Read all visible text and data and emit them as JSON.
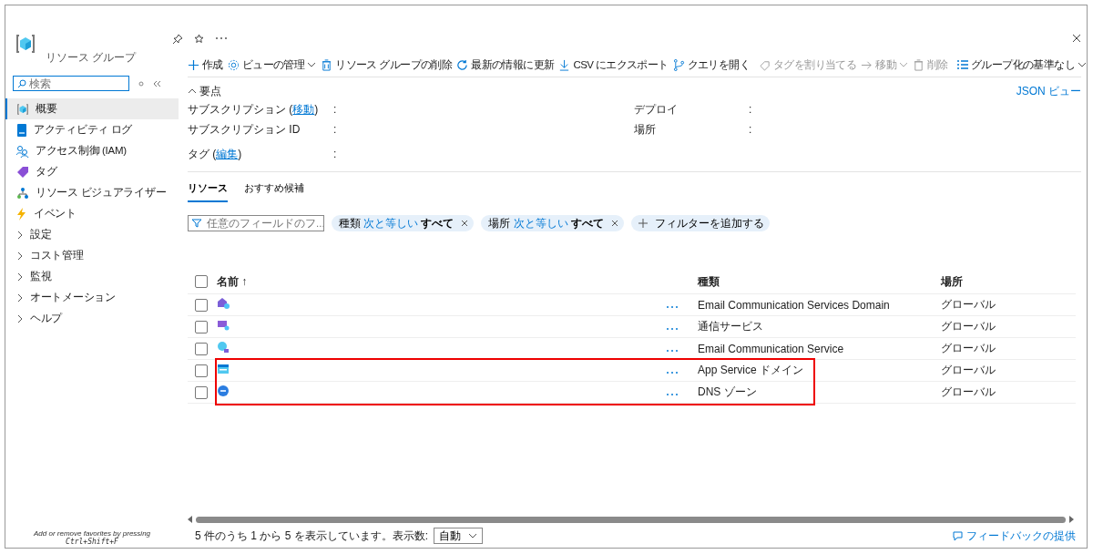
{
  "sidebar": {
    "title": "リソース グループ",
    "search": {
      "placeholder": "検索"
    },
    "items": [
      {
        "label": "概要",
        "kind": "link",
        "selected": true
      },
      {
        "label": "アクティビティ ログ",
        "kind": "link",
        "selected": false
      },
      {
        "label": "アクセス制御 (IAM)",
        "kind": "link",
        "selected": false
      },
      {
        "label": "タグ",
        "kind": "link",
        "selected": false
      },
      {
        "label": "リソース ビジュアライザー",
        "kind": "link",
        "selected": false
      },
      {
        "label": "イベント",
        "kind": "link",
        "selected": false
      },
      {
        "label": "設定",
        "kind": "group",
        "selected": false
      },
      {
        "label": "コスト管理",
        "kind": "group",
        "selected": false
      },
      {
        "label": "監視",
        "kind": "group",
        "selected": false
      },
      {
        "label": "オートメーション",
        "kind": "group",
        "selected": false
      },
      {
        "label": "ヘルプ",
        "kind": "group",
        "selected": false
      }
    ],
    "footer": "Add or remove favorites by pressing",
    "shortcut": "Ctrl+Shift+F"
  },
  "toolbar": [
    {
      "label": "作成",
      "disabled": false,
      "dropdown": false
    },
    {
      "label": "ビューの管理",
      "disabled": false,
      "dropdown": true
    },
    {
      "label": "リソース グループの削除",
      "disabled": false,
      "dropdown": false
    },
    {
      "label": "最新の情報に更新",
      "disabled": false,
      "dropdown": false
    },
    {
      "label": "CSV にエクスポート",
      "disabled": false,
      "dropdown": false
    },
    {
      "label": "クエリを開く",
      "disabled": false,
      "dropdown": false
    },
    {
      "label": "タグを割り当てる",
      "disabled": true,
      "dropdown": false
    },
    {
      "label": "移動",
      "disabled": true,
      "dropdown": true
    },
    {
      "label": "削除",
      "disabled": true,
      "dropdown": false
    }
  ],
  "group_by": "グループ化の基準なし",
  "essentials": {
    "toggle": "要点",
    "json_view": "JSON ビュー",
    "left": [
      {
        "before": "サブスクリプション (",
        "link": "移動",
        "after": ")",
        "colon": ":"
      },
      {
        "before": "サブスクリプション ID",
        "colon": ":"
      },
      {
        "before": "タグ (",
        "link": "編集",
        "after": ")",
        "colon": ":"
      }
    ],
    "right": [
      {
        "before": "デプロイ",
        "colon": ":"
      },
      {
        "before": "場所",
        "colon": ":"
      }
    ]
  },
  "tabs": [
    {
      "label": "リソース",
      "selected": true
    },
    {
      "label": "おすすめ候補",
      "selected": false
    }
  ],
  "filter": {
    "placeholder": "任意のフィールドのフ...",
    "pills": [
      {
        "field": "種類",
        "op": "次と等しい",
        "value": "すべて"
      },
      {
        "field": "場所",
        "op": "次と等しい",
        "value": "すべて"
      }
    ],
    "add": "フィルターを追加する"
  },
  "table": {
    "select_all": {
      "checked": false
    },
    "columns": [
      "名前 ↑",
      "種類",
      "場所"
    ],
    "rows": [
      {
        "type": "Email Communication Services Domain",
        "location": "グローバル",
        "checked": false,
        "highlighted": false
      },
      {
        "type": "通信サービス",
        "location": "グローバル",
        "checked": false,
        "highlighted": false
      },
      {
        "type": "Email Communication Service",
        "location": "グローバル",
        "checked": false,
        "highlighted": false
      },
      {
        "type": "App Service ドメイン",
        "location": "グローバル",
        "checked": false,
        "highlighted": true
      },
      {
        "type": "DNS ゾーン",
        "location": "グローバル",
        "checked": false,
        "highlighted": true
      }
    ]
  },
  "footer": {
    "summary": "5 件のうち 1 から 5 を表示しています。表示数:",
    "page_size": "自動",
    "feedback": "フィードバックの提供"
  }
}
